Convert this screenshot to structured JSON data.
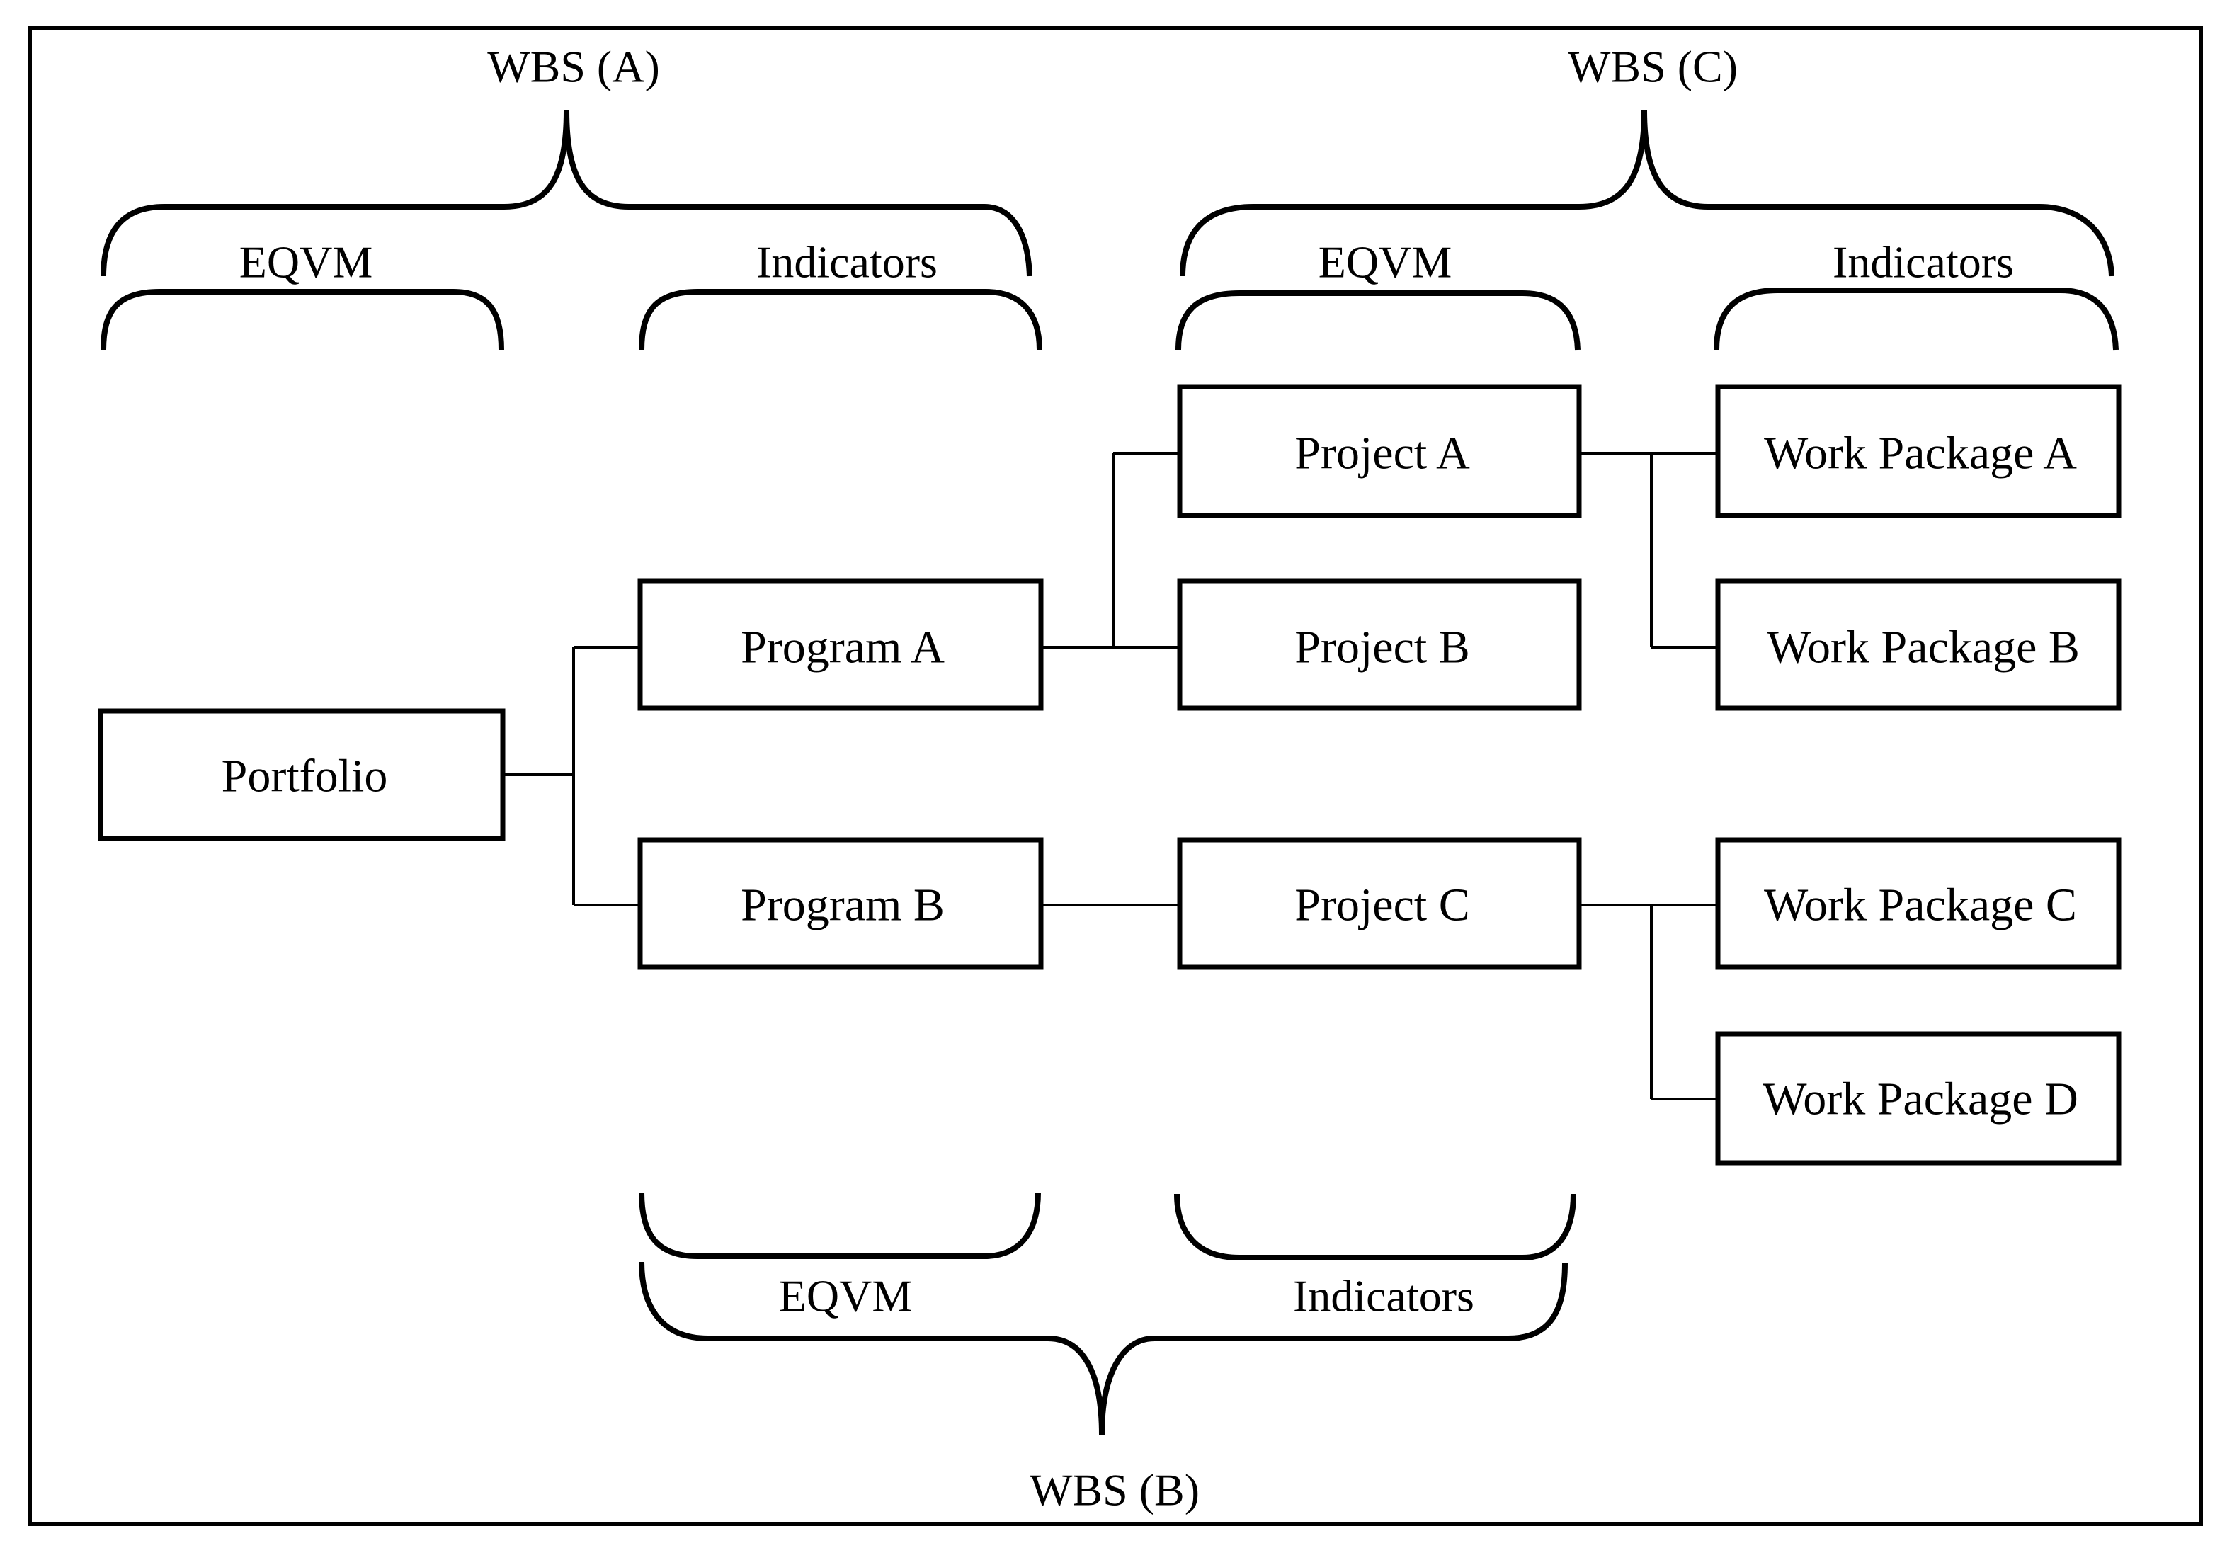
{
  "diagram": {
    "type": "hierarchy",
    "nodes": {
      "portfolio": "Portfolio",
      "program_a": "Program A",
      "program_b": "Program B",
      "project_a": "Project A",
      "project_b": "Project B",
      "project_c": "Project C",
      "work_package_a": "Work Package A",
      "work_package_b": "Work Package B",
      "work_package_c": "Work Package C",
      "work_package_d": "Work Package D"
    },
    "edges": [
      [
        "Portfolio",
        "Program A"
      ],
      [
        "Portfolio",
        "Program B"
      ],
      [
        "Program A",
        "Project A"
      ],
      [
        "Program A",
        "Project B"
      ],
      [
        "Program B",
        "Project C"
      ],
      [
        "Project A",
        "Work Package A"
      ],
      [
        "Project A",
        "Work Package B"
      ],
      [
        "Project C",
        "Work Package C"
      ],
      [
        "Project C",
        "Work Package D"
      ]
    ],
    "groups": {
      "wbs_a": {
        "label": "WBS (A)",
        "eqvm_label": "EQVM",
        "indicators_label": "Indicators"
      },
      "wbs_b": {
        "label": "WBS (B)",
        "eqvm_label": "EQVM",
        "indicators_label": "Indicators"
      },
      "wbs_c": {
        "label": "WBS (C)",
        "eqvm_label": "EQVM",
        "indicators_label": "Indicators"
      }
    }
  }
}
